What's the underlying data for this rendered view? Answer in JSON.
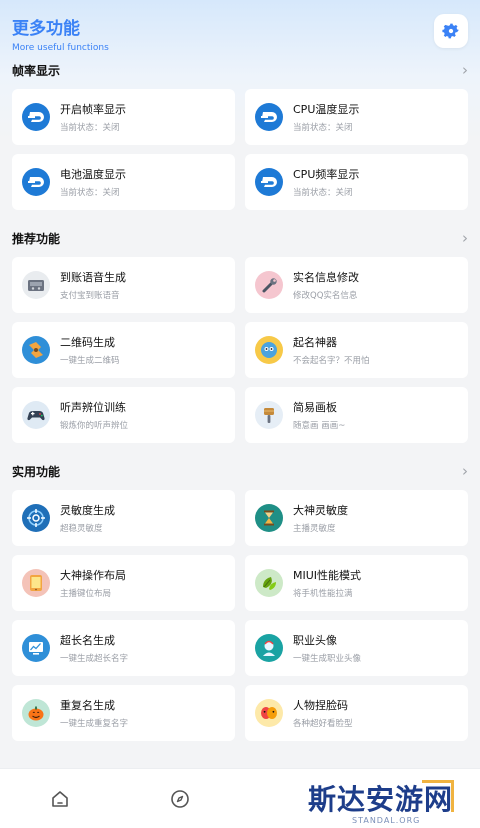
{
  "header": {
    "title": "更多功能",
    "subtitle": "More useful functions"
  },
  "sections": [
    {
      "label": "帧率显示",
      "items": [
        {
          "title": "开启帧率显示",
          "sub": "当前状态：关闭",
          "icon": "dash-icon"
        },
        {
          "title": "CPU温度显示",
          "sub": "当前状态：关闭",
          "icon": "dash-icon"
        },
        {
          "title": "电池温度显示",
          "sub": "当前状态：关闭",
          "icon": "dash-icon"
        },
        {
          "title": "CPU频率显示",
          "sub": "当前状态：关闭",
          "icon": "dash-icon"
        }
      ]
    },
    {
      "label": "推荐功能",
      "items": [
        {
          "title": "到账语音生成",
          "sub": "支付宝到账语音",
          "icon": "radio-icon"
        },
        {
          "title": "实名信息修改",
          "sub": "修改QQ实名信息",
          "icon": "wrench-icon"
        },
        {
          "title": "二维码生成",
          "sub": "一键生成二维码",
          "icon": "qrcode-icon"
        },
        {
          "title": "起名神器",
          "sub": "不会起名字？不用怕",
          "icon": "mascot-icon"
        },
        {
          "title": "听声辨位训练",
          "sub": "锻炼你的听声辨位",
          "icon": "gamepad-icon"
        },
        {
          "title": "简易画板",
          "sub": "随意画 画画~",
          "icon": "brush-icon"
        }
      ]
    },
    {
      "label": "实用功能",
      "items": [
        {
          "title": "灵敏度生成",
          "sub": "超稳灵敏度",
          "icon": "target-icon"
        },
        {
          "title": "大神灵敏度",
          "sub": "主播灵敏度",
          "icon": "hourglass-icon"
        },
        {
          "title": "大神操作布局",
          "sub": "主播键位布局",
          "icon": "tablet-icon"
        },
        {
          "title": "MIUI性能模式",
          "sub": "将手机性能拉满",
          "icon": "leaf-icon"
        },
        {
          "title": "超长名生成",
          "sub": "一键生成超长名字",
          "icon": "chart-icon"
        },
        {
          "title": "职业头像",
          "sub": "一键生成职业头像",
          "icon": "avatar-icon"
        },
        {
          "title": "重复名生成",
          "sub": "一键生成重复名字",
          "icon": "pumpkin-icon"
        },
        {
          "title": "人物捏脸码",
          "sub": "各种超好看脸型",
          "icon": "mask-icon"
        }
      ]
    }
  ],
  "colors": {
    "accent": "#3b82f6",
    "dash_icon_bg": "#1e7ad6"
  },
  "nav": {
    "items": [
      "home-icon",
      "compass-icon"
    ]
  },
  "watermark": {
    "text": "斯达安游网",
    "url": "STANDAL.ORG"
  }
}
